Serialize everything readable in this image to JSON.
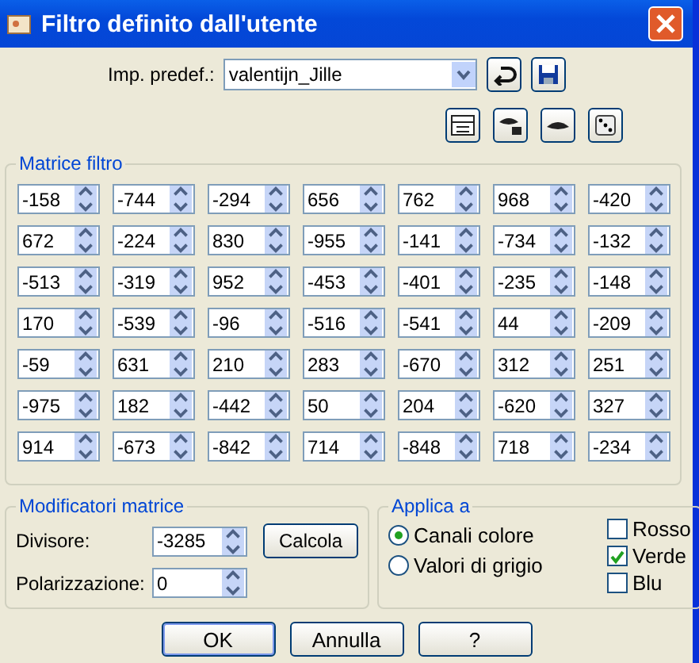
{
  "window": {
    "title": "Filtro definito dall'utente"
  },
  "preset": {
    "label": "Imp. predef.:",
    "value": "valentijn_Jille"
  },
  "matrix": {
    "title": "Matrice filtro",
    "rows": [
      [
        "-158",
        "-744",
        "-294",
        "656",
        "762",
        "968",
        "-420"
      ],
      [
        "672",
        "-224",
        "830",
        "-955",
        "-141",
        "-734",
        "-132"
      ],
      [
        "-513",
        "-319",
        "952",
        "-453",
        "-401",
        "-235",
        "-148"
      ],
      [
        "170",
        "-539",
        "-96",
        "-516",
        "-541",
        "44",
        "-209"
      ],
      [
        "-59",
        "631",
        "210",
        "283",
        "-670",
        "312",
        "251"
      ],
      [
        "-975",
        "182",
        "-442",
        "50",
        "204",
        "-620",
        "327"
      ],
      [
        "914",
        "-673",
        "-842",
        "714",
        "-848",
        "718",
        "-234"
      ]
    ]
  },
  "modifiers": {
    "title": "Modificatori matrice",
    "divisor": {
      "label": "Divisore:",
      "value": "-3285"
    },
    "bias": {
      "label": "Polarizzazione:",
      "value": "0"
    },
    "calculate_button": "Calcola"
  },
  "apply_to": {
    "title": "Applica a",
    "options": [
      {
        "label": "Canali colore",
        "selected": true
      },
      {
        "label": "Valori di grigio",
        "selected": false
      }
    ],
    "channels": [
      {
        "label": "Rosso",
        "checked": false
      },
      {
        "label": "Verde",
        "checked": true
      },
      {
        "label": "Blu",
        "checked": false
      }
    ]
  },
  "buttons": [
    "OK",
    "Annulla",
    "?"
  ]
}
